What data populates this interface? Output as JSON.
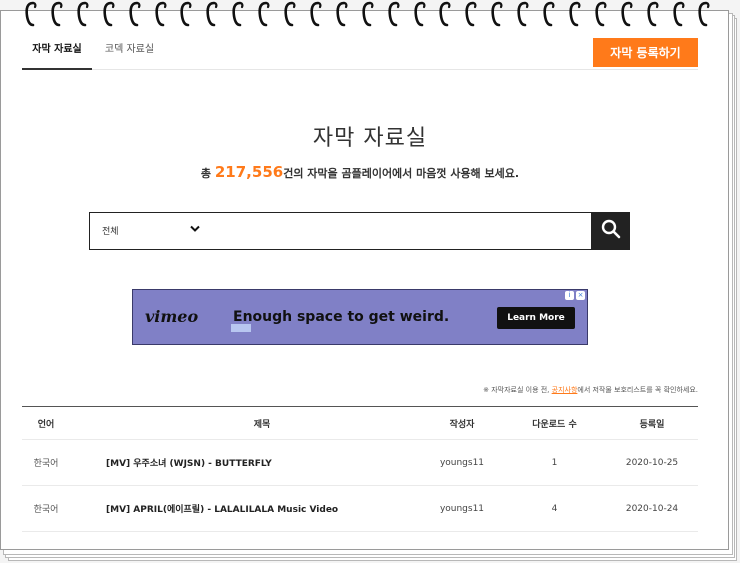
{
  "tabs": [
    {
      "label": "자막 자료실"
    },
    {
      "label": "코덱 자료실"
    }
  ],
  "register_button": "자막 등록하기",
  "page_title": "자막 자료실",
  "subtitle": {
    "prefix": "총 ",
    "count": "217,556",
    "suffix": "건의 자막을 곰플레이어에서 마음껏 사용해 보세요."
  },
  "search": {
    "category": "전체",
    "value": "",
    "placeholder": ""
  },
  "ad": {
    "brand": "vimeo",
    "headline": "Enough space to get weird.",
    "cta": "Learn More"
  },
  "notice": {
    "prefix": "※ 자막자료실 이용 전, ",
    "link": "공지사항",
    "suffix": "에서 저작물 보호리스트를 꼭 확인하세요."
  },
  "table": {
    "headers": {
      "lang": "언어",
      "title": "제목",
      "author": "작성자",
      "downloads": "다운로드 수",
      "date": "등록일"
    },
    "rows": [
      {
        "lang": "한국어",
        "title": "[MV] 우주소녀 (WJSN) - BUTTERFLY",
        "author": "youngs11",
        "downloads": "1",
        "date": "2020-10-25"
      },
      {
        "lang": "한국어",
        "title": "[MV] APRIL(에이프릴) - LALALILALA Music Video",
        "author": "youngs11",
        "downloads": "4",
        "date": "2020-10-24"
      }
    ]
  },
  "colors": {
    "accent": "#ff7a1a",
    "ad_bg": "#8080c6"
  }
}
